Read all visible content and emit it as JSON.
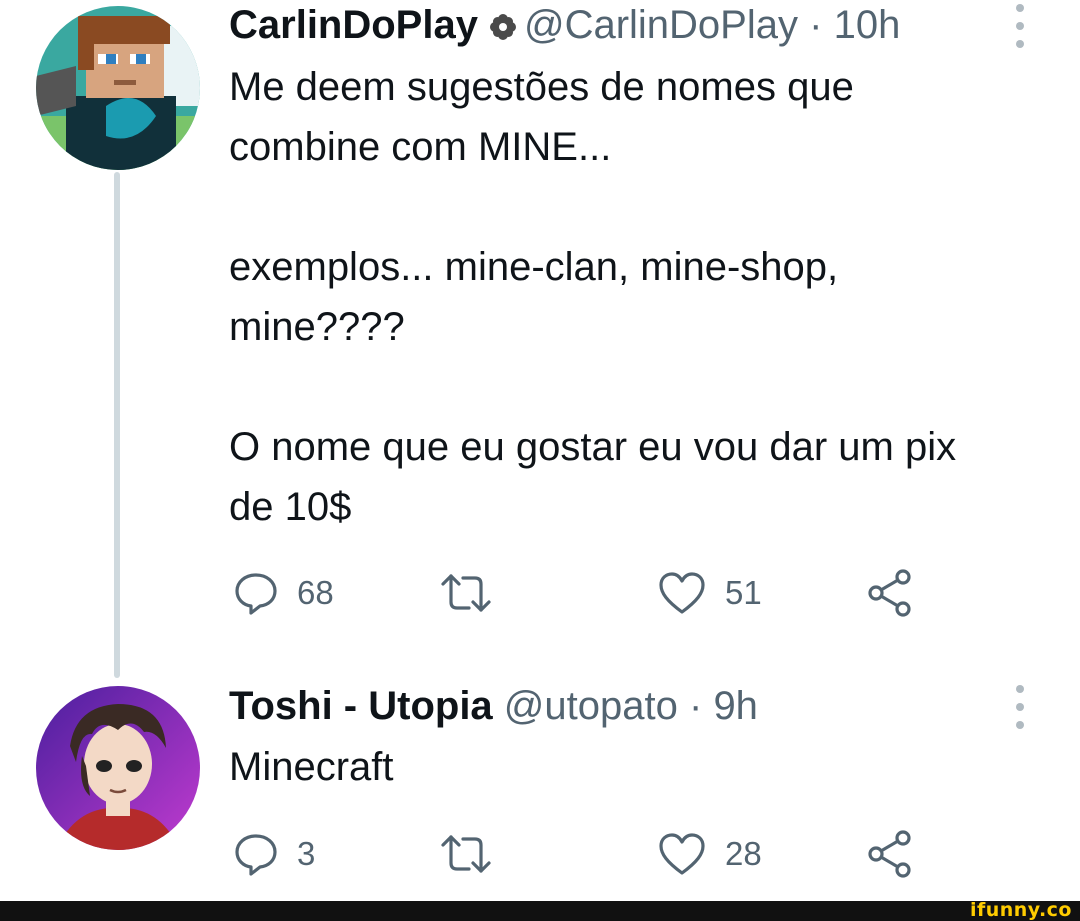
{
  "tweets": [
    {
      "display_name": "CarlinDoPlay",
      "handle": "@CarlinDoPlay",
      "separator": "·",
      "time": "10h",
      "text": "Me deem sugestões de nomes que\ncombine com MINE...\n\nexemplos... mine-clan, mine-shop,\nmine????\n\nO nome que eu gostar eu vou dar um pix\nde 10$",
      "replies": "68",
      "retweets": "",
      "likes": "51",
      "badge_icon": "flower-badge-icon",
      "avatar_icon": "minecraft-character-avatar"
    },
    {
      "display_name": "Toshi - Utopia",
      "handle": "@utopato",
      "separator": "·",
      "time": "9h",
      "text": "Minecraft",
      "replies": "3",
      "retweets": "",
      "likes": "28",
      "avatar_icon": "anime-character-avatar"
    }
  ],
  "watermark": "ifunny.co",
  "colors": {
    "text": "#0f1419",
    "meta": "#536471",
    "thread_line": "#cfd9de",
    "footer": "#111111",
    "watermark": "#ffcc00"
  }
}
